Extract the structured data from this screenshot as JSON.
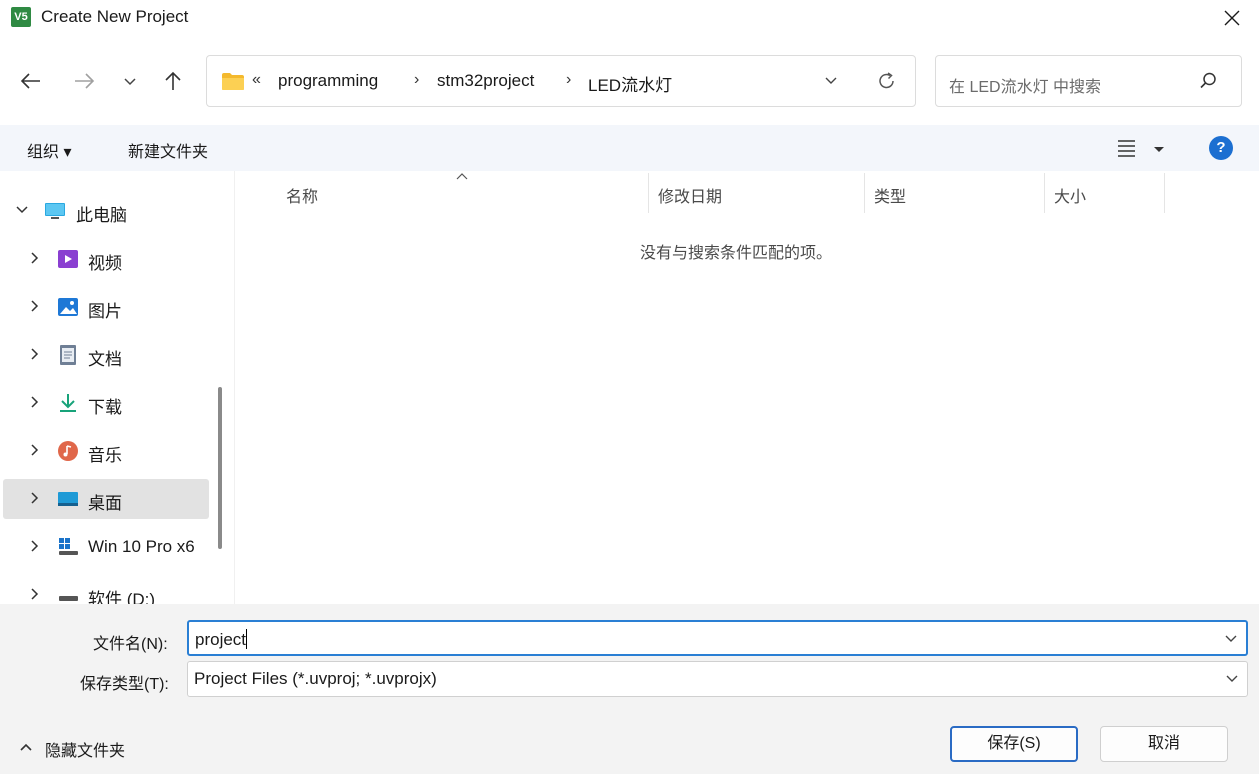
{
  "window": {
    "app_icon_text": "V5",
    "title": "Create New Project"
  },
  "address_bar": {
    "overflow": "«",
    "crumbs": [
      "programming",
      "stm32project",
      "LED流水灯"
    ],
    "separator": "›"
  },
  "search": {
    "placeholder": "在 LED流水灯 中搜索"
  },
  "commands": {
    "organize": "组织 ▾",
    "new_folder": "新建文件夹",
    "help": "?"
  },
  "sidebar": {
    "items": [
      {
        "label": "此电脑",
        "icon": "computer-icon",
        "expanded": true
      },
      {
        "label": "视频",
        "icon": "videos-icon"
      },
      {
        "label": "图片",
        "icon": "pictures-icon"
      },
      {
        "label": "文档",
        "icon": "documents-icon"
      },
      {
        "label": "下载",
        "icon": "downloads-icon"
      },
      {
        "label": "音乐",
        "icon": "music-icon"
      },
      {
        "label": "桌面",
        "icon": "desktop-icon",
        "selected": true
      },
      {
        "label": "Win 10 Pro x6",
        "icon": "windows-drive-icon"
      },
      {
        "label": "软件 (D:)",
        "icon": "drive-icon"
      }
    ]
  },
  "file_list": {
    "columns": [
      "名称",
      "修改日期",
      "类型",
      "大小"
    ],
    "empty_message": "没有与搜索条件匹配的项。"
  },
  "form": {
    "filename_label": "文件名(N):",
    "filename_value": "project",
    "filetype_label": "保存类型(T):",
    "filetype_value": "Project Files (*.uvproj; *.uvprojx)"
  },
  "footer": {
    "hide_folders": "隐藏文件夹",
    "save": "保存(S)",
    "cancel": "取消"
  },
  "colors": {
    "accent": "#2a7fd4",
    "command_bar_bg": "#f3f6fb",
    "footer_bg": "#f3f3f3",
    "selected_item_bg": "#e2e2e2"
  }
}
